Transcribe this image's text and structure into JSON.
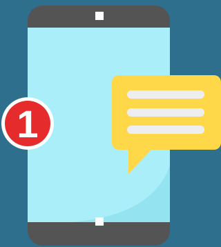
{
  "notification": {
    "badge_count": "1",
    "badge_color": "#e52b2b",
    "bubble_color": "#ffd84a",
    "bubble_line_color": "#eeeeee"
  },
  "phone": {
    "body_color": "#545454",
    "screen_color": "#a9eef8",
    "icons": [
      "phone-icon",
      "speaker-icon",
      "home-button-icon",
      "chat-bubble-icon"
    ]
  },
  "background_color": "#2e6f8e"
}
